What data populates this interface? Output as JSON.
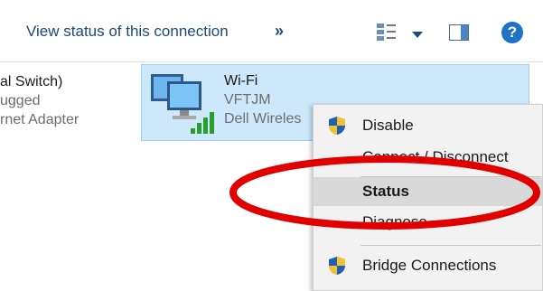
{
  "toolbar": {
    "view_status_label": "View status of this connection",
    "more_label": "»",
    "icons": [
      "change-view-icon",
      "dropdown-arrow-icon",
      "preview-pane-icon",
      "help-icon"
    ],
    "help_label": "?"
  },
  "adapters": [
    {
      "name": "al Switch)",
      "status": "ugged",
      "device": "rnet Adapter"
    },
    {
      "name": "Wi-Fi",
      "status": "VFTJM",
      "device": "Dell Wireles"
    }
  ],
  "context_menu": {
    "items": [
      {
        "label": "Disable",
        "icon": "uac-shield-icon"
      },
      {
        "label": "Connect / Disconnect"
      },
      {
        "label": "Status",
        "highlighted": true
      },
      {
        "label": "Diagnose"
      },
      {
        "label": "Bridge Connections",
        "icon": "uac-shield-icon"
      }
    ]
  },
  "colors": {
    "selection": "#cde8fb",
    "annotation": "#e00000",
    "link": "#1b4a7a",
    "help": "#1e73c8"
  }
}
